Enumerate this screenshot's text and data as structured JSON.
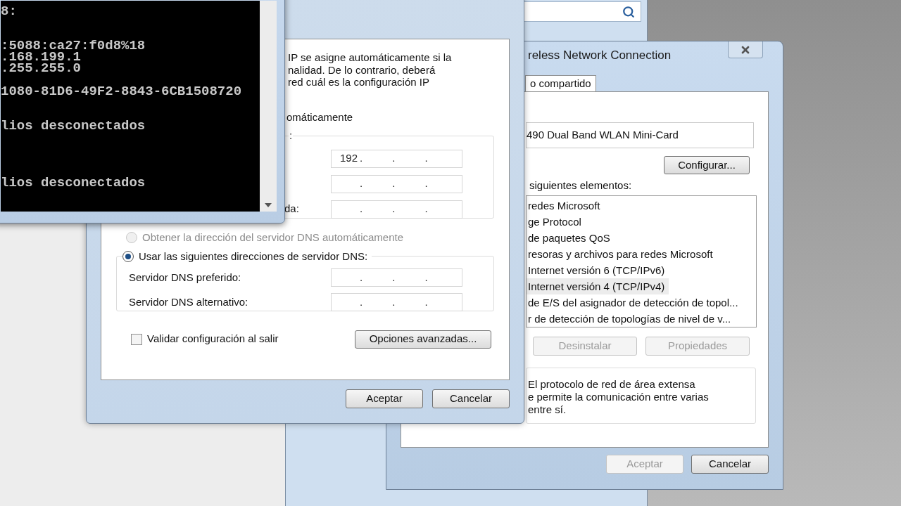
{
  "console": {
    "blocks": [
      [
        "8:"
      ],
      [
        ":5088:ca27:f0d8%18",
        ".168.199.1",
        ".255.255.0"
      ],
      [
        "1080-81D6-49F2-8843-6CB1508720"
      ],
      [
        "lios desconectados"
      ],
      [
        "lios desconectados"
      ]
    ]
  },
  "ipv4_dialog": {
    "intro": [
      "IP se asigne automáticamente si la",
      "nalidad. De lo contrario, deberá",
      "red cuál es la configuración IP"
    ],
    "ip_option_label": "omáticamente",
    "ip_group_legend": ":",
    "ip_fields": [
      {
        "octets": [
          "192"
        ],
        "separator": "."
      },
      {
        "separator": "."
      },
      {
        "label": "da:",
        "separator": "."
      }
    ],
    "dns_options": [
      {
        "label": "Obtener la dirección del servidor DNS automáticamente",
        "selected": false,
        "disabled": true
      },
      {
        "label": "Usar las siguientes direcciones de servidor DNS:",
        "selected": true,
        "disabled": false
      }
    ],
    "dns_fields": [
      {
        "label": "Servidor DNS preferido:",
        "separator": "."
      },
      {
        "label": "Servidor DNS alternativo:",
        "separator": "."
      }
    ],
    "validate": {
      "label": "Validar configuración al salir",
      "checked": false
    },
    "advanced_button": "Opciones avanzadas...",
    "buttons": [
      "Aceptar",
      "Cancelar"
    ]
  },
  "wifi_dialog": {
    "title": "reless Network Connection",
    "tab": {
      "label": "o compartido",
      "selected": true
    },
    "adapter": "490 Dual Band WLAN Mini-Card",
    "configure_button": "Configurar...",
    "items_label": "siguientes elementos:",
    "items": [
      {
        "label": "redes Microsoft",
        "selected": false
      },
      {
        "label": "ge Protocol",
        "selected": false
      },
      {
        "label": "de paquetes QoS",
        "selected": false
      },
      {
        "label": "resoras y archivos para redes Microsoft",
        "selected": false
      },
      {
        "label": "Internet versión 6 (TCP/IPv6)",
        "selected": false
      },
      {
        "label": "Internet versión 4 (TCP/IPv4)",
        "selected": true
      },
      {
        "label": "de E/S del asignador de detección de topol...",
        "selected": false
      },
      {
        "label": "r de detección de topologías de nivel de v...",
        "selected": false
      }
    ],
    "actions": [
      {
        "label": "Desinstalar",
        "disabled": true
      },
      {
        "label": "Propiedades",
        "disabled": true
      }
    ],
    "description": [
      "El protocolo de red de área extensa",
      "e permite la comunicación entre varias",
      "entre sí."
    ],
    "buttons": [
      {
        "label": "Aceptar",
        "disabled": true
      },
      {
        "label": "Cancelar",
        "disabled": false
      }
    ]
  }
}
